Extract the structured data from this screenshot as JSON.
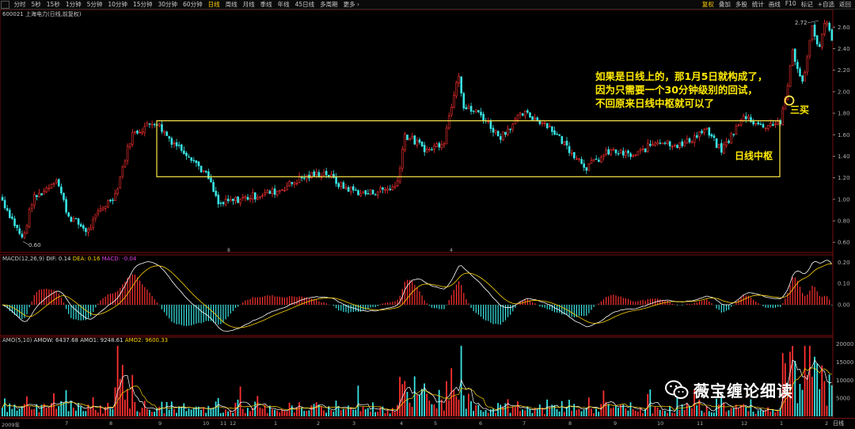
{
  "toolbar": {
    "periods": [
      "分时",
      "5秒",
      "15秒",
      "1分钟",
      "5分钟",
      "10分钟",
      "15分钟",
      "30分钟",
      "60分钟",
      "日线",
      "周线",
      "月线",
      "季线",
      "年线",
      "45日线",
      "多周期",
      "更多 ›"
    ],
    "active_period": "日线",
    "tools": [
      "复权",
      "叠加",
      "多股",
      "统计",
      "画线",
      "F10",
      "标记",
      "+自选",
      "返回"
    ]
  },
  "stock": {
    "label": "600021 上海电力(日线,前复权)",
    "high_marker": "2.72",
    "low_marker": "0.60"
  },
  "price_axis": [
    "2.60",
    "2.40",
    "2.20",
    "2.00",
    "1.80",
    "1.60",
    "1.40",
    "1.20",
    "1.00",
    "0.80",
    "0.60"
  ],
  "macd": {
    "name": "MACD(12,26,9)",
    "dif_label": "DIF: 0.14",
    "dea_label": "DEA: 0.16",
    "macd_label": "MACD: -0.04",
    "axis": [
      "0.20",
      "0.10",
      "0.00"
    ]
  },
  "amo": {
    "name": "AMO(5,10)",
    "amow_label": "AMOW: 6437.68",
    "amo1_label": "AMO1: 9248.61",
    "amo2_label": "AMO2: 9600.33",
    "axis": [
      "20000",
      "15000",
      "10000",
      "5000"
    ]
  },
  "annotation": {
    "lines": [
      "如果是日线上的，那1月5日就构成了，",
      "因为只需要一个30分钟级别的回试，",
      "不回原来日线中枢就可以了"
    ],
    "sanmai": "三买",
    "zhongshu": "日线中枢"
  },
  "watermark": "薇宝缠论细读",
  "mid_markers": [
    "8",
    "4"
  ],
  "x_axis": [
    "2009年",
    "7",
    "8",
    "9",
    "10",
    "11",
    "12",
    "1",
    "2",
    "3",
    "4",
    "5",
    "6",
    "7",
    "8",
    "9",
    "10",
    "11",
    "12",
    "1",
    "2"
  ],
  "period_indicator": "日线",
  "colors": {
    "up": "#ff3030",
    "down": "#39e5e5",
    "dif": "#ffffff",
    "dea": "#ffd200",
    "box": "#ffe84a",
    "grid": "#7a1010"
  }
}
